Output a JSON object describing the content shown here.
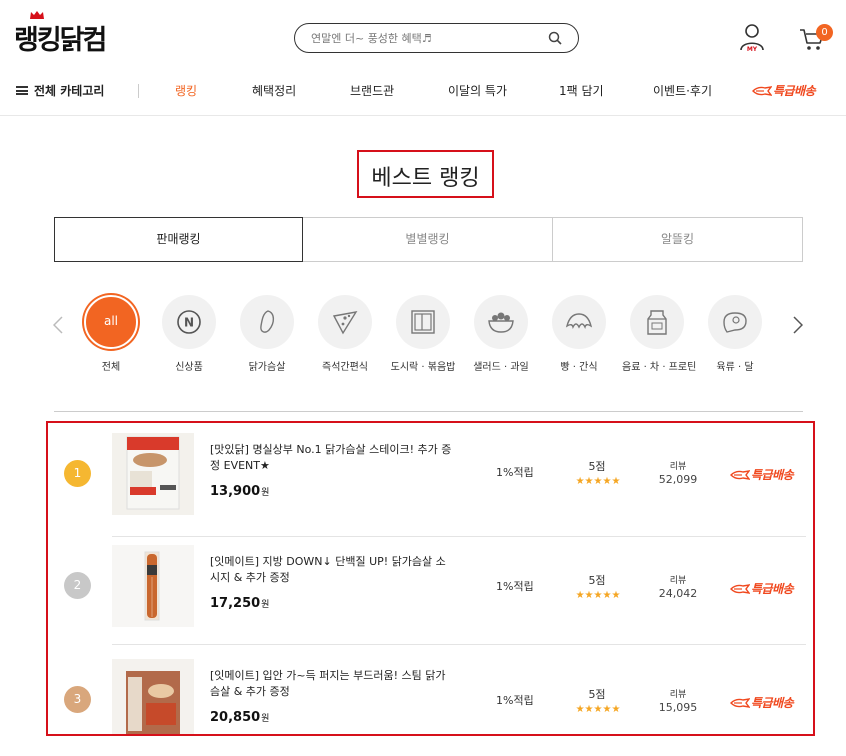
{
  "header": {
    "logo": "랭킹닭컴",
    "search_placeholder": "연말엔 더~ 풍성한 혜택♬",
    "my_label": "MY",
    "cart_count": "0"
  },
  "nav": {
    "all_categories": "전체 카테고리",
    "items": [
      "랭킹",
      "혜택정리",
      "브랜드관",
      "이달의 특가",
      "1팩 담기",
      "이벤트·후기"
    ],
    "delivery_label": "특급배송"
  },
  "page_title": "베스트 랭킹",
  "tabs": [
    "판매랭킹",
    "별별랭킹",
    "알뜰킹"
  ],
  "categories": [
    "전체",
    "신상품",
    "닭가슴살",
    "즉석간편식",
    "도시락 · 볶음밥",
    "샐러드 · 과일",
    "빵 · 간식",
    "음료 · 차 · 프로틴",
    "육류 · 달"
  ],
  "category_all_icon_text": "all",
  "category_new_icon_text": "N",
  "products": [
    {
      "rank": "1",
      "name": "[맛있닭] 명실상부 No.1 닭가슴살 스테이크! 추가 증정 EVENT★",
      "price": "13,900",
      "currency": "원",
      "point": "1%적립",
      "score": "5점",
      "stars": "★★★★★",
      "review_label": "리뷰",
      "review_count": "52,099",
      "delivery": "특급배송",
      "rank_color": "#f5b731"
    },
    {
      "rank": "2",
      "name": "[잇메이트] 지방 DOWN↓ 단백질 UP! 닭가슴살 소시지 & 추가 증정",
      "price": "17,250",
      "currency": "원",
      "point": "1%적립",
      "score": "5점",
      "stars": "★★★★★",
      "review_label": "리뷰",
      "review_count": "24,042",
      "delivery": "특급배송",
      "rank_color": "#c8c8c8"
    },
    {
      "rank": "3",
      "name": "[잇메이트] 입안 가~득 퍼지는 부드러움! 스팀 닭가슴살 & 추가 증정",
      "price": "20,850",
      "currency": "원",
      "point": "1%적립",
      "score": "5점",
      "stars": "★★★★★",
      "review_label": "리뷰",
      "review_count": "15,095",
      "delivery": "특급배송",
      "rank_color": "#d9a77c"
    }
  ],
  "colors": {
    "accent": "#f26522",
    "highlight_border": "#d6101a",
    "delivery_red": "#f0481e",
    "star": "#f5a623"
  }
}
